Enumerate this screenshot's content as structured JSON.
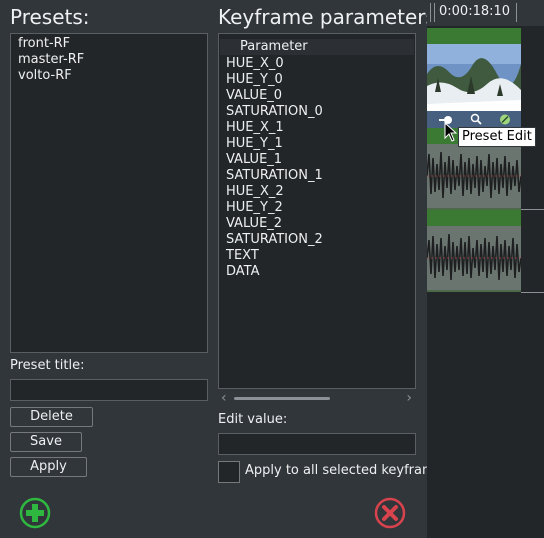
{
  "presets": {
    "title": "Presets:",
    "items": [
      "front-RF",
      "master-RF",
      "volto-RF"
    ],
    "title_label": "Preset title:",
    "title_value": "",
    "delete_label": "Delete",
    "save_label": "Save",
    "apply_label": "Apply"
  },
  "keyframes": {
    "title": "Keyframe parameters",
    "column_header": "Parameter",
    "params": [
      "HUE_X_0",
      "HUE_Y_0",
      "VALUE_0",
      "SATURATION_0",
      "HUE_X_1",
      "HUE_Y_1",
      "VALUE_1",
      "SATURATION_1",
      "HUE_X_2",
      "HUE_Y_2",
      "VALUE_2",
      "SATURATION_2",
      "TEXT",
      "DATA"
    ],
    "edit_value_label": "Edit value:",
    "edit_value": "",
    "apply_all_label": "Apply to all selected keyframes",
    "apply_all_checked": false
  },
  "timeline": {
    "timecode": "0:00:18:10"
  },
  "tooltip": {
    "text": "Preset Edit"
  },
  "icons": {
    "add": "plus-circle-icon",
    "remove": "x-circle-icon"
  },
  "colors": {
    "add_green": "#2fb83f",
    "remove_red": "#d8434d",
    "clip_green": "#3a7a33"
  }
}
